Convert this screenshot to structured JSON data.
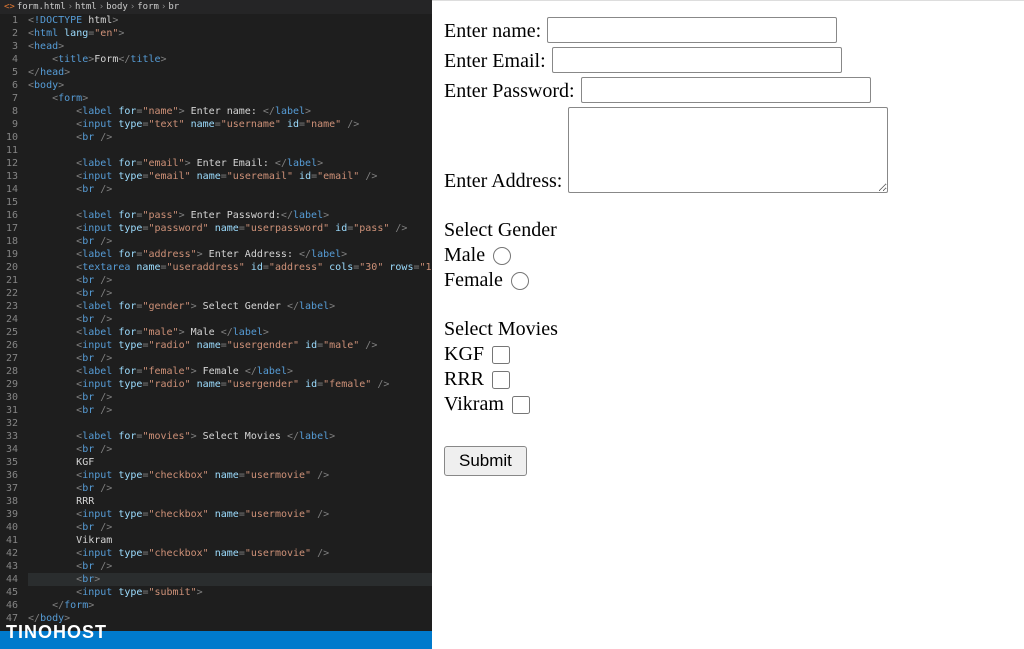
{
  "breadcrumb": {
    "file": "form.html",
    "parts": [
      "html",
      "body",
      "form",
      "br"
    ]
  },
  "code": {
    "lines": [
      "<!DOCTYPE html>",
      "<html lang=\"en\">",
      "<head>",
      "  <title>Form</title>",
      "</head>",
      "<body>",
      "  <form>",
      "    <label for=\"name\"> Enter name: </label>",
      "    <input type=\"text\" name=\"username\" id=\"name\" />",
      "    <br />",
      "",
      "    <label for=\"email\"> Enter Email: </label>",
      "    <input type=\"email\" name=\"useremail\" id=\"email\" />",
      "    <br />",
      "",
      "    <label for=\"pass\"> Enter Password:</label>",
      "    <input type=\"password\" name=\"userpassword\" id=\"pass\" />",
      "    <br />",
      "    <label for=\"address\"> Enter Address: </label>",
      "    <textarea name=\"useraddress\" id=\"address\" cols=\"30\" rows=\"10\"> </textar",
      "    <br />",
      "    <br />",
      "    <label for=\"gender\"> Select Gender </label>",
      "    <br />",
      "    <label for=\"male\"> Male </label>",
      "    <input type=\"radio\" name=\"usergender\" id=\"male\" />",
      "    <br />",
      "    <label for=\"female\"> Female </label>",
      "    <input type=\"radio\" name=\"usergender\" id=\"female\" />",
      "    <br />",
      "    <br />",
      "",
      "    <label for=\"movies\"> Select Movies </label>",
      "    <br />",
      "    KGF",
      "    <input type=\"checkbox\" name=\"usermovie\" />",
      "    <br />",
      "    RRR",
      "    <input type=\"checkbox\" name=\"usermovie\" />",
      "    <br />",
      "    Vikram",
      "    <input type=\"checkbox\" name=\"usermovie\" />",
      "    <br />",
      "    <br>",
      "    <input type=\"submit\">",
      "  </form>",
      "</body>"
    ]
  },
  "form": {
    "name_label": "Enter name:",
    "email_label": "Enter Email:",
    "password_label": "Enter Password:",
    "address_label": "Enter Address:",
    "gender_label": "Select Gender",
    "male_label": "Male",
    "female_label": "Female",
    "movies_label": "Select Movies",
    "movie1": "KGF",
    "movie2": "RRR",
    "movie3": "Vikram",
    "submit_label": "Submit"
  },
  "watermark": "TINOHOST"
}
